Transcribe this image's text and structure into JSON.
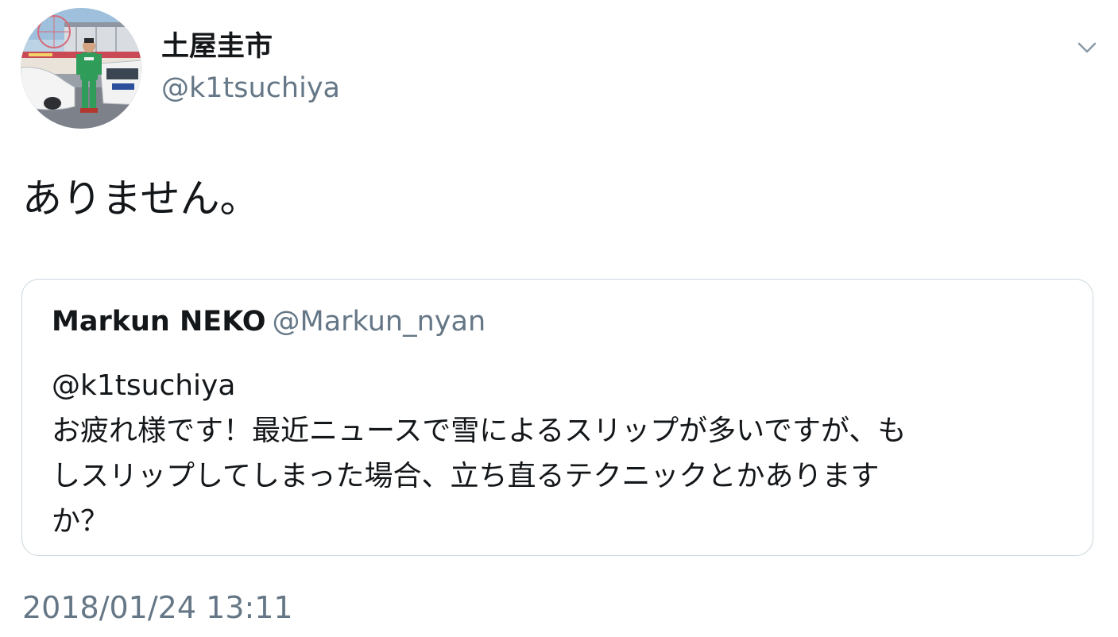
{
  "tweet": {
    "author": {
      "display_name": "土屋圭市",
      "handle": "@k1tsuchiya",
      "avatar": "avatar-photo"
    },
    "menu_icon": "chevron-down-icon",
    "text": "ありません。",
    "timestamp": "2018/01/24 13:11"
  },
  "quoted_tweet": {
    "display_name": "Markun NEKO",
    "handle": "@Markun_nyan",
    "lines": [
      "@k1tsuchiya",
      "お疲れ様です！最近ニュースで雪によるスリップが多いですが、も",
      "しスリップしてしまった場合、立ち直るテクニックとかあります",
      "か？"
    ]
  },
  "colors": {
    "text_primary": "#14171a",
    "text_secondary": "#657786",
    "border": "#ccd6dd",
    "background": "#ffffff"
  }
}
